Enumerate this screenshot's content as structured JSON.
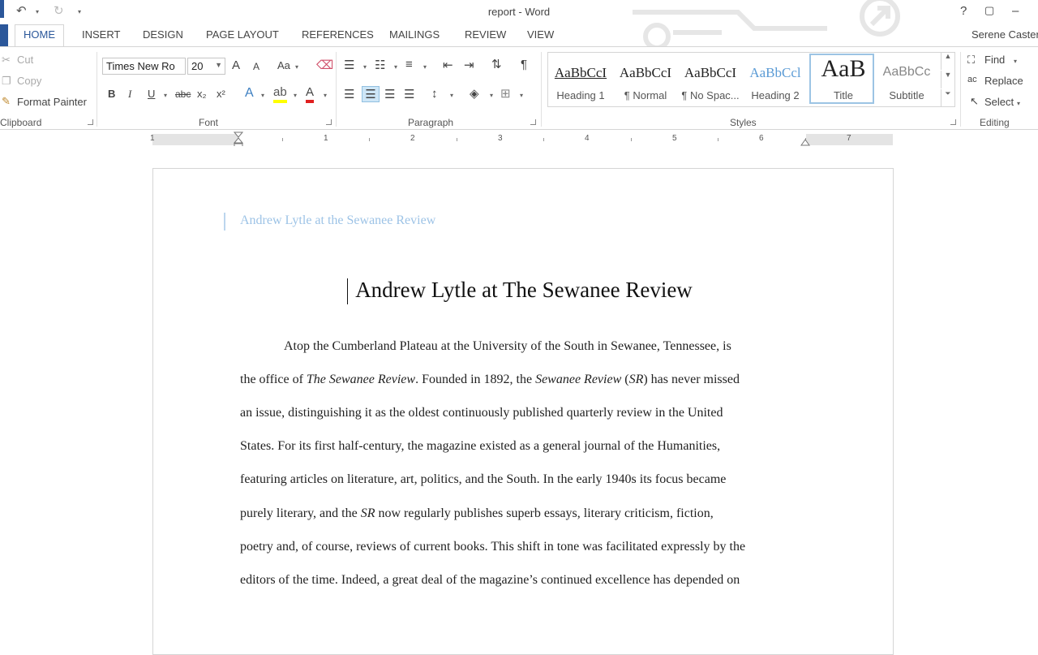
{
  "window": {
    "title": "report - Word"
  },
  "titlebar": {
    "help": "?",
    "minimize": "–",
    "restore": "▢"
  },
  "tabs": [
    {
      "label": "HOME",
      "active": true
    },
    {
      "label": "INSERT"
    },
    {
      "label": "DESIGN"
    },
    {
      "label": "PAGE LAYOUT"
    },
    {
      "label": "REFERENCES"
    },
    {
      "label": "MAILINGS"
    },
    {
      "label": "REVIEW"
    },
    {
      "label": "VIEW"
    }
  ],
  "user": "Serene Caster",
  "clipboard": {
    "cut": "Cut",
    "copy": "Copy",
    "format_painter": "Format Painter",
    "label": "Clipboard"
  },
  "font": {
    "name": "Times New Ro",
    "size": "20",
    "label": "Font",
    "bold": "B",
    "italic": "I",
    "underline": "U",
    "strike": "abc",
    "sub": "x₂",
    "sup": "x²",
    "case": "Aa",
    "grow": "A",
    "shrink": "A"
  },
  "paragraph": {
    "label": "Paragraph",
    "pilcrow": "¶"
  },
  "styles": {
    "label": "Styles",
    "items": [
      {
        "preview": "AaBbCcI",
        "name": "Heading 1"
      },
      {
        "preview": "AaBbCcI",
        "name": "¶ Normal"
      },
      {
        "preview": "AaBbCcI",
        "name": "¶ No Spac..."
      },
      {
        "preview": "AaBbCcl",
        "name": "Heading 2"
      },
      {
        "preview": "AaB",
        "name": "Title"
      },
      {
        "preview": "AaBbCc",
        "name": "Subtitle"
      }
    ]
  },
  "editing": {
    "find": "Find",
    "replace": "Replace",
    "select": "Select",
    "label": "Editing"
  },
  "ruler": {
    "numbers": [
      "1",
      "1",
      "2",
      "3",
      "4",
      "5",
      "6",
      "7"
    ]
  },
  "document": {
    "header": "Andrew Lytle at the Sewanee Review",
    "title": "Andrew Lytle at The Sewanee Review",
    "lines": [
      [
        "Atop the Cumberland Plateau at the University of the South in Sewanee, Tennessee, is"
      ],
      [
        "the office of ",
        "The Sewanee Review",
        ". Founded in 1892, the ",
        "Sewanee Review",
        " (",
        "SR",
        ") has never missed"
      ],
      [
        "an issue, distinguishing it as the oldest continuously published quarterly review in the United"
      ],
      [
        "States. For its first half-century, the magazine existed as a general journal of the Humanities,"
      ],
      [
        "featuring articles on literature, art, politics, and the South. In the early 1940s its focus became"
      ],
      [
        "purely literary, and the ",
        "SR",
        " now regularly publishes superb essays, literary criticism, fiction,"
      ],
      [
        "poetry and, of course, reviews of current books. This shift in tone was facilitated expressly by the"
      ],
      [
        "editors of the time. Indeed, a great deal of the magazine’s continued excellence has depended on"
      ]
    ]
  }
}
